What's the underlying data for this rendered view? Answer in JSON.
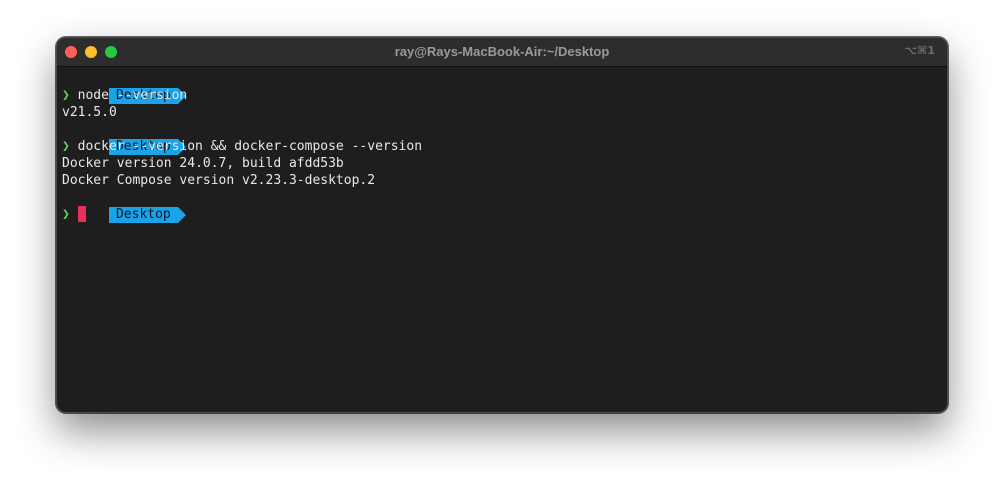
{
  "window": {
    "title": "ray@Rays-MacBook-Air:~/Desktop",
    "shortcut": "⌥⌘1"
  },
  "prompt": {
    "directory": "Desktop",
    "symbol": "❯"
  },
  "terminal": {
    "cmd1": "node --version",
    "out1": "v21.5.0",
    "cmd2": "docker --version && docker-compose --version",
    "out2": "Docker version 24.0.7, build afdd53b",
    "out3": "Docker Compose version v2.23.3-desktop.2"
  },
  "colors": {
    "segment_bg": "#1aa3e8",
    "prompt_symbol": "#5fd35f",
    "cursor": "#e8315a",
    "terminal_bg": "#1e1e1e"
  }
}
